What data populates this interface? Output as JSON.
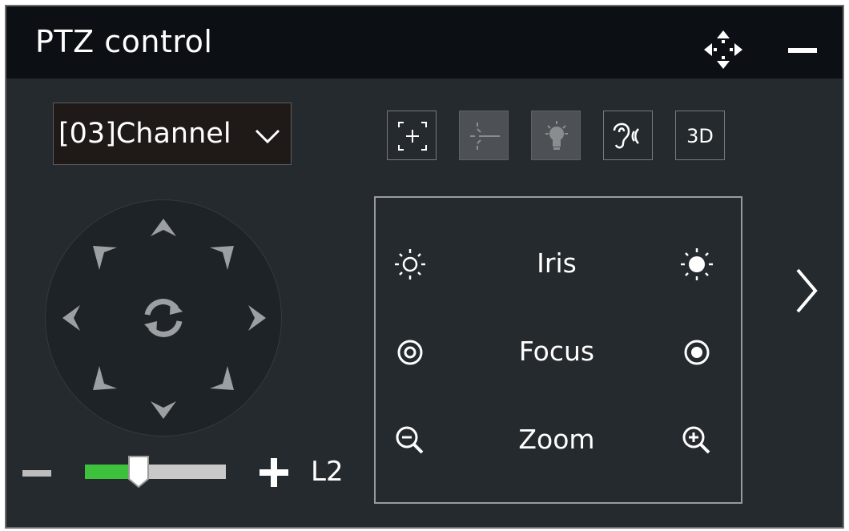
{
  "window": {
    "title": "PTZ control"
  },
  "channel_select": {
    "selected": "[03]Channel"
  },
  "toolbar": {
    "buttons": [
      {
        "name": "manual-track-button",
        "icon": "target-plus-icon",
        "enabled": true
      },
      {
        "name": "laser-button",
        "icon": "laser-icon",
        "enabled": false
      },
      {
        "name": "light-button",
        "icon": "bulb-icon",
        "enabled": false
      },
      {
        "name": "audio-button",
        "icon": "ear-sound-icon",
        "enabled": true
      },
      {
        "name": "3d-positioning-button",
        "label": "3D",
        "enabled": true
      }
    ]
  },
  "speed": {
    "level_label": "L2",
    "fraction": 0.38
  },
  "lens": {
    "iris_label": "Iris",
    "focus_label": "Focus",
    "zoom_label": "Zoom"
  },
  "colors": {
    "background": "#252a2f",
    "titlebar": "#0c1014",
    "accent_green": "#3ec23e",
    "arrow_gray": "#9da0a2"
  }
}
